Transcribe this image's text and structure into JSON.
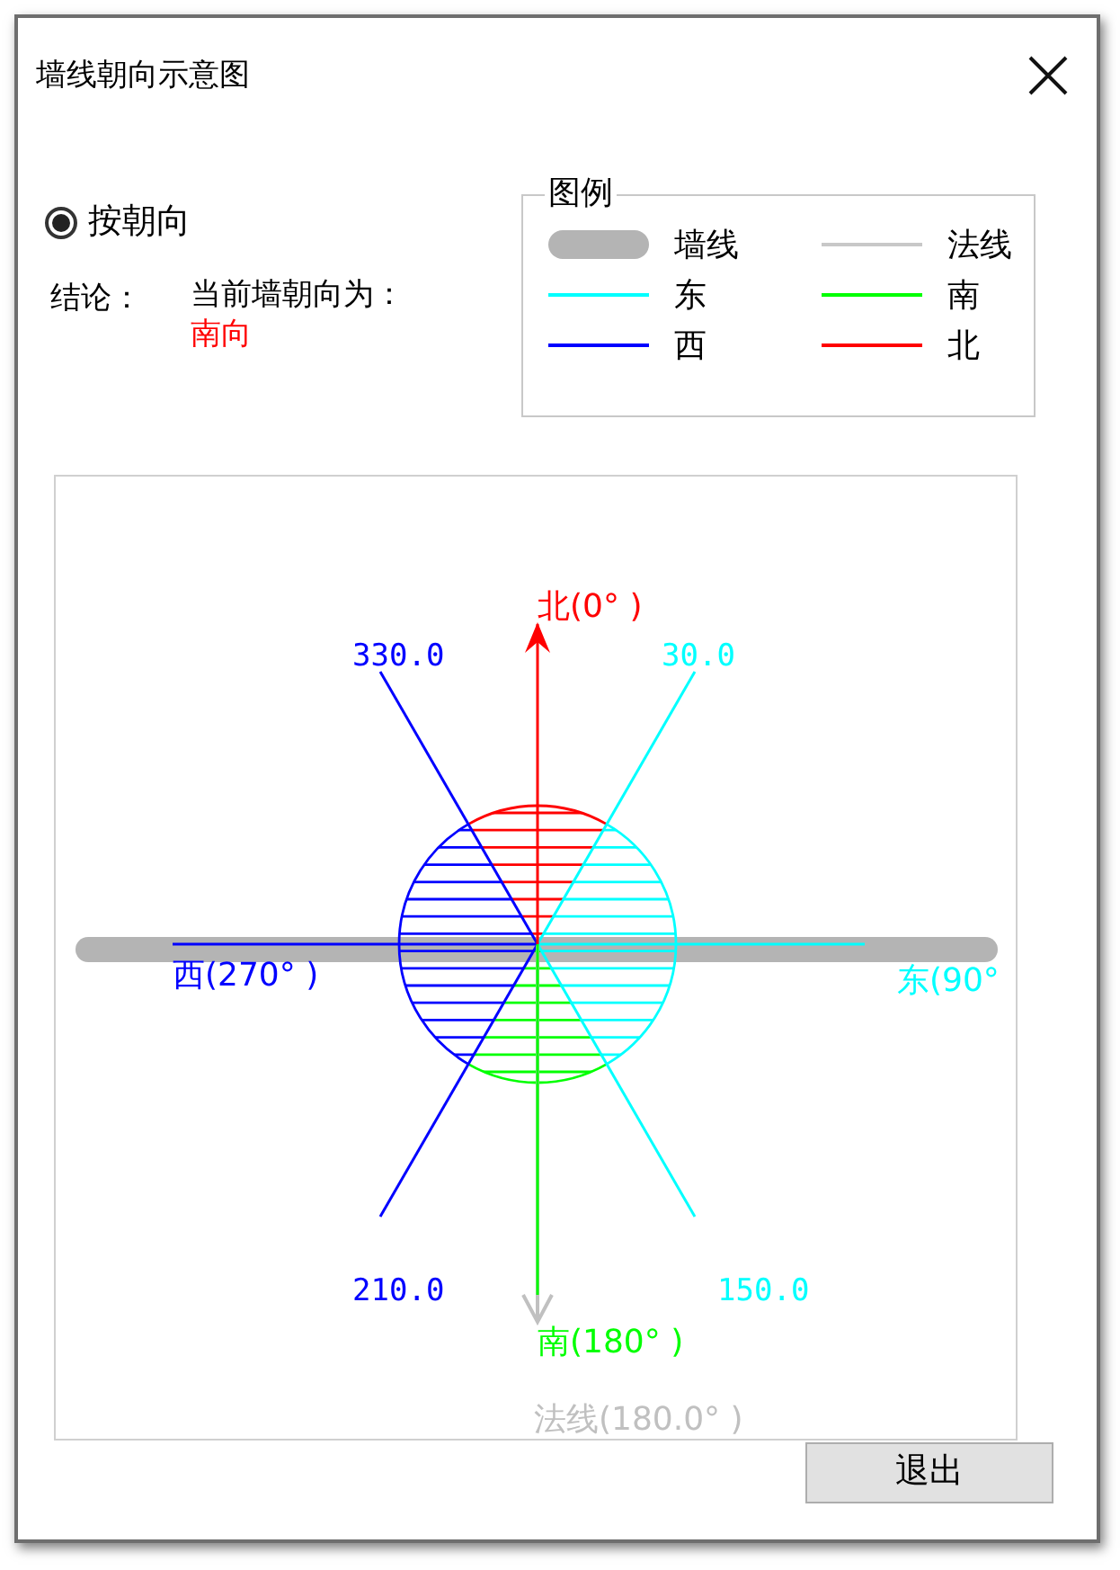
{
  "window": {
    "title": "墙线朝向示意图"
  },
  "mode": {
    "label": "按朝向",
    "checked": true
  },
  "conclusion": {
    "label": "结论：",
    "text": "当前墙朝向为：",
    "value": "南向"
  },
  "legend": {
    "title": "图例",
    "items": [
      {
        "kind": "wall",
        "label": "墙线",
        "color": "#b4b4b4"
      },
      {
        "kind": "line",
        "label": "法线",
        "color": "#c8c8c8"
      },
      {
        "kind": "line",
        "label": "东",
        "color": "#00ffff"
      },
      {
        "kind": "line",
        "label": "南",
        "color": "#00ff00"
      },
      {
        "kind": "line",
        "label": "西",
        "color": "#0000ff"
      },
      {
        "kind": "line",
        "label": "北",
        "color": "#ff0000"
      }
    ]
  },
  "diagram": {
    "directions": [
      {
        "label": "北(0° )",
        "color": "#ff0000"
      },
      {
        "label": "东(90°",
        "color": "#00ffff"
      },
      {
        "label": "南(180° )",
        "color": "#00ff00"
      },
      {
        "label": "西(270° )",
        "color": "#0000ff"
      }
    ],
    "boundaries": [
      {
        "label": "330.0",
        "color": "#0000ff"
      },
      {
        "label": "30.0",
        "color": "#00ffff"
      },
      {
        "label": "210.0",
        "color": "#0000ff"
      },
      {
        "label": "150.0",
        "color": "#00ffff"
      }
    ],
    "normal": {
      "label": "法线(180.0° )",
      "color": "#c0c0c0"
    },
    "wall": {
      "color": "#b4b4b4"
    }
  },
  "buttons": [
    {
      "label": "退出"
    }
  ]
}
